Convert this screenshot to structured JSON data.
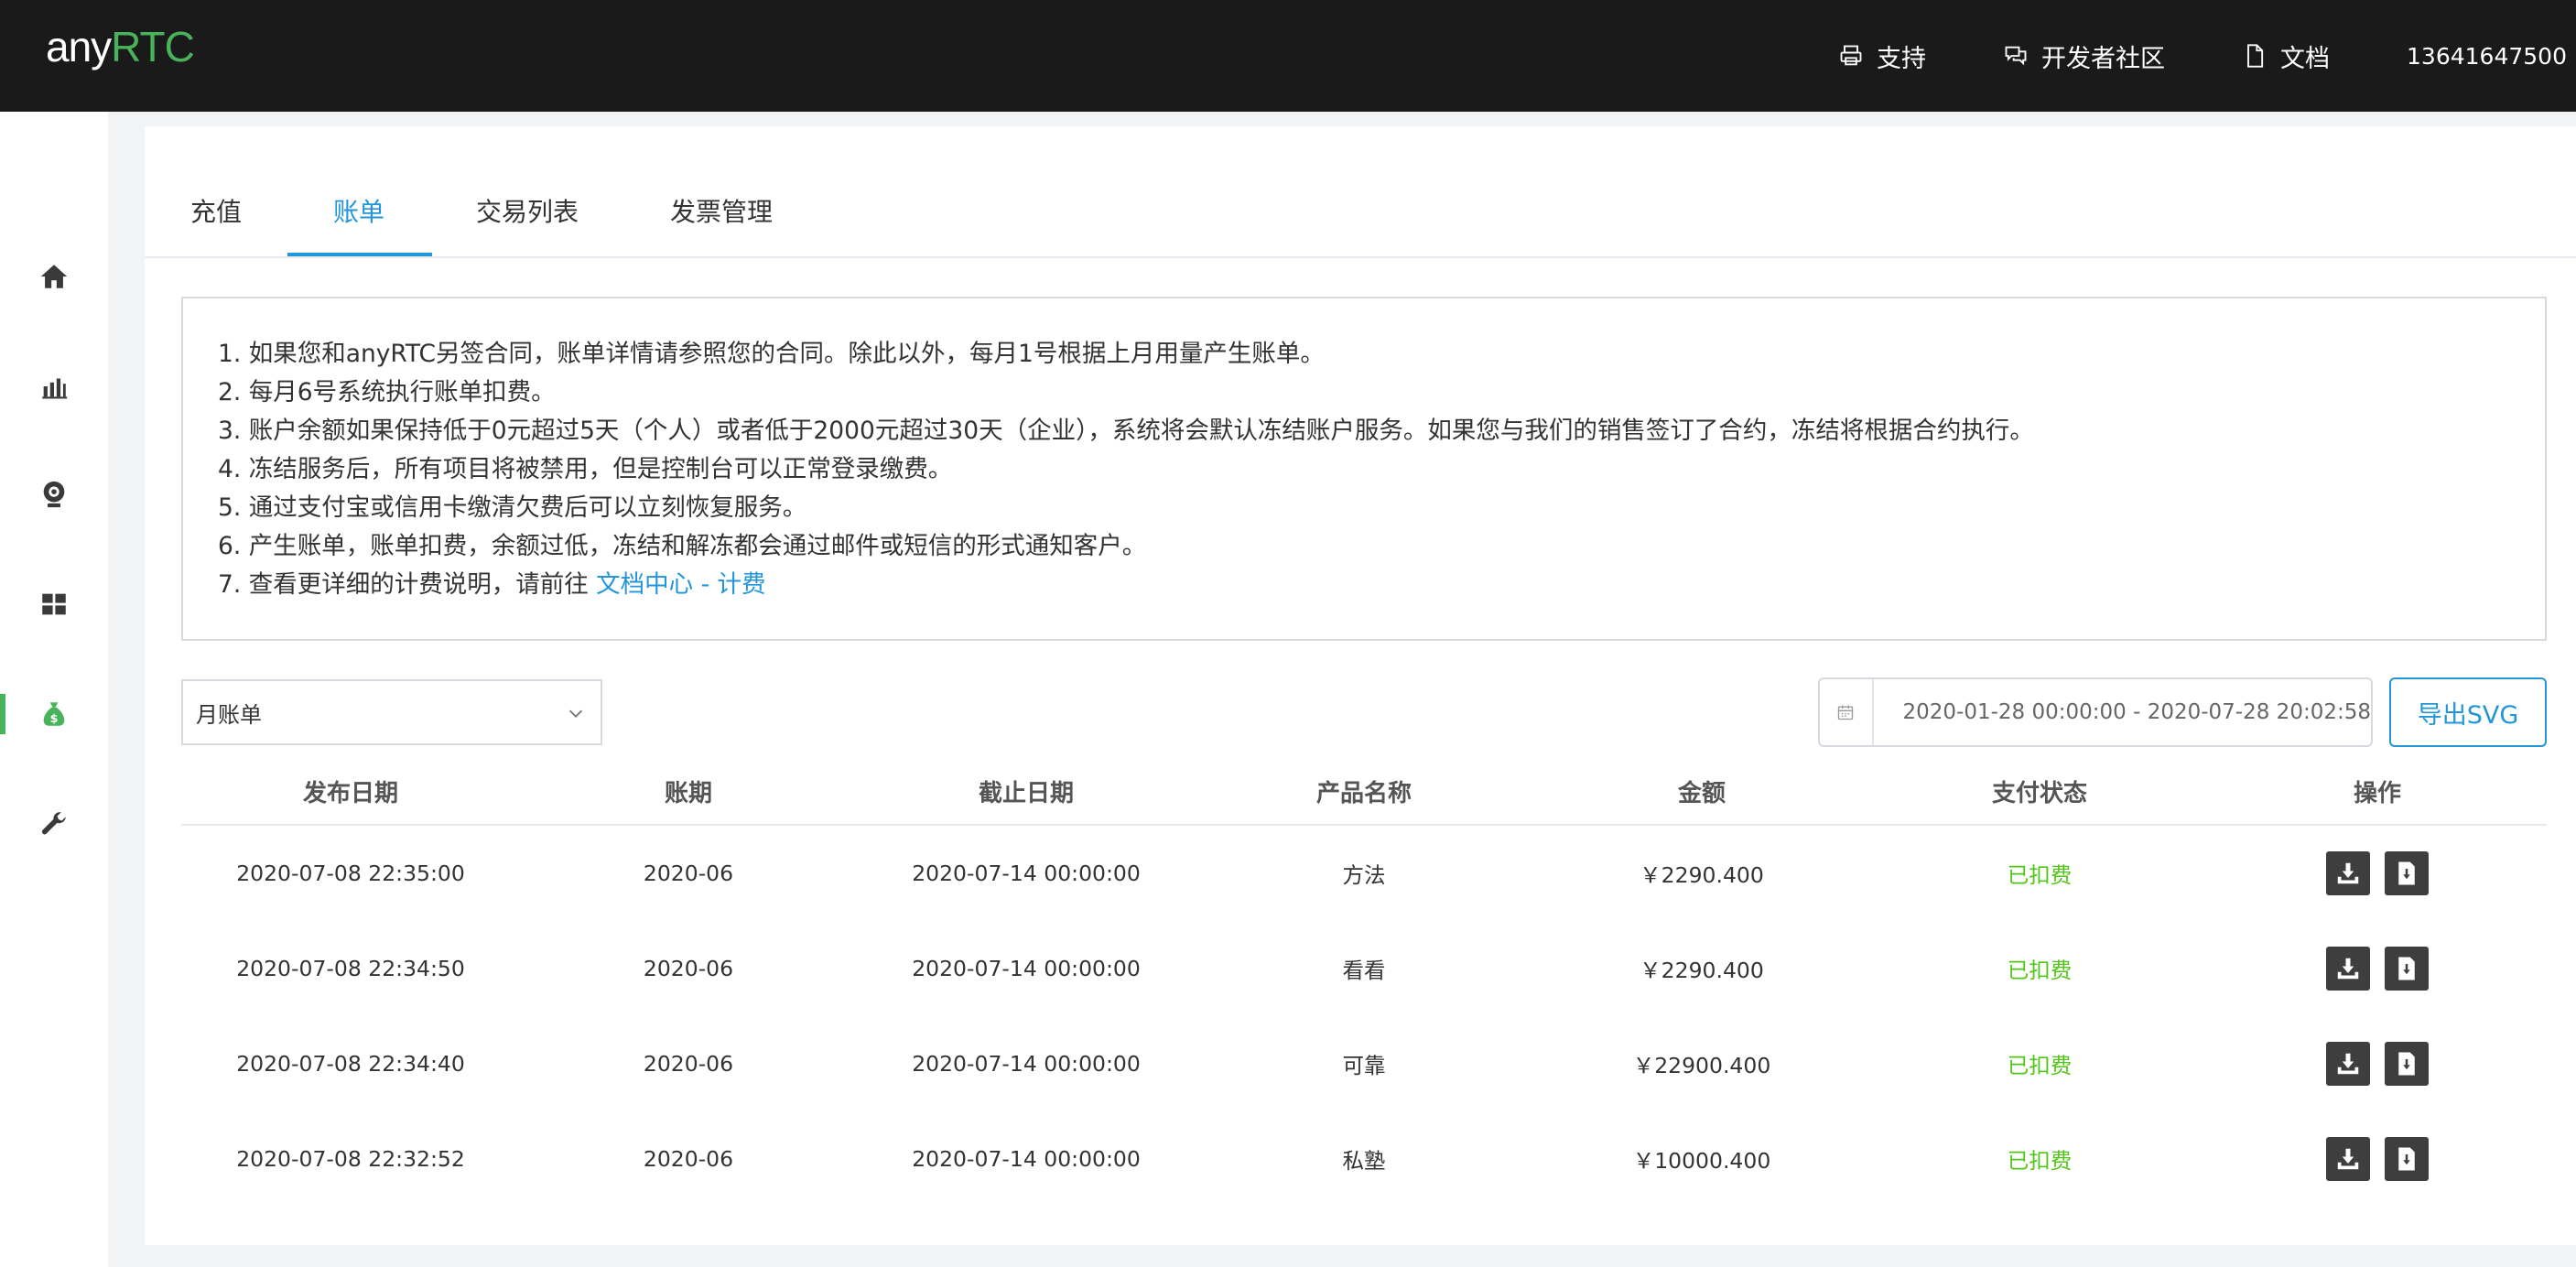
{
  "header": {
    "logo_any": "any",
    "logo_rtc": "RTC",
    "nav": [
      {
        "label": "支持",
        "icon": "printer-icon"
      },
      {
        "label": "开发者社区",
        "icon": "chat-icon"
      },
      {
        "label": "文档",
        "icon": "document-icon"
      }
    ],
    "user": "13641647500"
  },
  "sidebar": {
    "items": [
      {
        "icon": "home-icon",
        "active": false
      },
      {
        "icon": "bar-chart-icon",
        "active": false
      },
      {
        "icon": "webcam-icon",
        "active": false
      },
      {
        "icon": "grid-icon",
        "active": false
      },
      {
        "icon": "money-bag-icon",
        "active": true
      },
      {
        "icon": "wrench-icon",
        "active": false
      }
    ]
  },
  "tabs": [
    {
      "label": "充值",
      "active": false
    },
    {
      "label": "账单",
      "active": true
    },
    {
      "label": "交易列表",
      "active": false
    },
    {
      "label": "发票管理",
      "active": false
    }
  ],
  "notice": {
    "lines": [
      "1. 如果您和anyRTC另签合同，账单详情请参照您的合同。除此以外，每月1号根据上月用量产生账单。",
      "2. 每月6号系统执行账单扣费。",
      "3. 账户余额如果保持低于0元超过5天（个人）或者低于2000元超过30天（企业），系统将会默认冻结账户服务。如果您与我们的销售签订了合约，冻结将根据合约执行。",
      "4. 冻结服务后，所有项目将被禁用，但是控制台可以正常登录缴费。",
      "5. 通过支付宝或信用卡缴清欠费后可以立刻恢复服务。",
      "6. 产生账单，账单扣费，余额过低，冻结和解冻都会通过邮件或短信的形式通知客户。"
    ],
    "last_prefix": "7. 查看更详细的计费说明，请前往 ",
    "last_link": "文档中心 - 计费"
  },
  "filters": {
    "select_value": "月账单",
    "date_range": "2020-01-28 00:00:00 - 2020-07-28 20:02:58",
    "export_label": "导出SVG"
  },
  "table": {
    "columns": [
      "发布日期",
      "账期",
      "截止日期",
      "产品名称",
      "金额",
      "支付状态",
      "操作"
    ],
    "rows": [
      {
        "publish": "2020-07-08 22:35:00",
        "period": "2020-06",
        "deadline": "2020-07-14 00:00:00",
        "product": "方法",
        "amount": "￥2290.400",
        "status": "已扣费"
      },
      {
        "publish": "2020-07-08 22:34:50",
        "period": "2020-06",
        "deadline": "2020-07-14 00:00:00",
        "product": "看看",
        "amount": "￥2290.400",
        "status": "已扣费"
      },
      {
        "publish": "2020-07-08 22:34:40",
        "period": "2020-06",
        "deadline": "2020-07-14 00:00:00",
        "product": "可靠",
        "amount": "￥22900.400",
        "status": "已扣费"
      },
      {
        "publish": "2020-07-08 22:32:52",
        "period": "2020-06",
        "deadline": "2020-07-14 00:00:00",
        "product": "私塾",
        "amount": "￥10000.400",
        "status": "已扣费"
      }
    ]
  },
  "colors": {
    "header_bg": "#1a1a1a",
    "brand_green": "#48b35a",
    "accent_blue": "#2196d9",
    "paid_green": "#52c41a"
  }
}
